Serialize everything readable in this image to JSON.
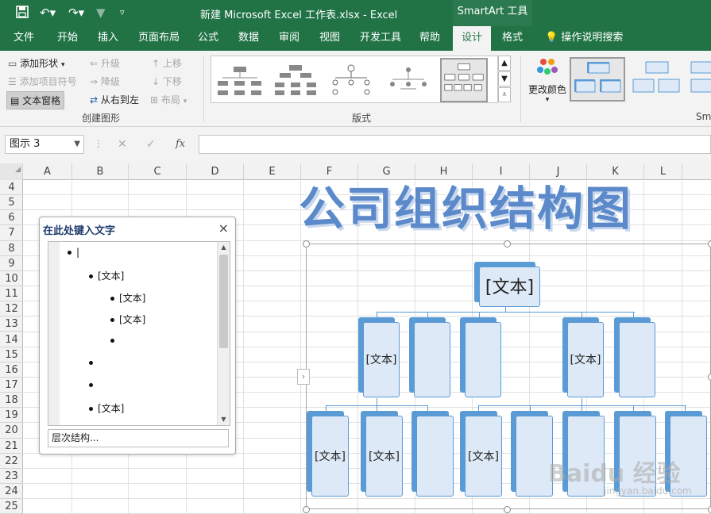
{
  "title_bar": {
    "doc_title": "新建 Microsoft Excel 工作表.xlsx  -  Excel",
    "context_label": "SmartArt 工具"
  },
  "tabs": [
    "文件",
    "开始",
    "插入",
    "页面布局",
    "公式",
    "数据",
    "审阅",
    "视图",
    "开发工具",
    "帮助",
    "设计",
    "格式"
  ],
  "active_tab": "设计",
  "tell_me": "操作说明搜索",
  "ribbon": {
    "create_graphic": {
      "add_shape": "添加形状",
      "add_bullet": "添加项目符号",
      "text_pane": "文本窗格",
      "promote": "升级",
      "demote": "降级",
      "right_to_left": "从右到左",
      "move_up": "上移",
      "move_down": "下移",
      "layout": "布局",
      "group_label": "创建图形"
    },
    "layouts": {
      "group_label": "版式"
    },
    "change_colors": "更改颜色",
    "styles_label_partial": "Sm"
  },
  "formula_bar": {
    "name_box": "图示 3",
    "cancel": "✕",
    "enter": "✓",
    "fx": "fx",
    "value": ""
  },
  "columns": [
    "A",
    "B",
    "C",
    "D",
    "E",
    "F",
    "G",
    "H",
    "I",
    "J",
    "K",
    "L"
  ],
  "rows": [
    "4",
    "5",
    "6",
    "7",
    "8",
    "9",
    "10",
    "11",
    "12",
    "13",
    "14",
    "15",
    "16",
    "17",
    "18",
    "19",
    "20",
    "21",
    "22",
    "23",
    "24",
    "25"
  ],
  "text_pane": {
    "title": "在此处键入文字",
    "close": "×",
    "bullets": [
      "",
      "[文本]",
      "[文本]",
      "[文本]",
      "",
      "",
      "",
      "[文本]"
    ],
    "footer": "层次结构..."
  },
  "wordart_title": "公司组织结构图",
  "smartart": {
    "top": "[文本]",
    "level2": [
      "[文本]",
      "",
      "",
      "[文本]",
      ""
    ],
    "level3": [
      "[文本]",
      "[文本]",
      "",
      "[文本]",
      "",
      "",
      "",
      ""
    ]
  },
  "watermark": {
    "main": "Baidu 经验",
    "sub": "jingyan.baidu.com"
  },
  "colors": {
    "excel_green": "#217346",
    "smartart_blue": "#5b9bd5",
    "box_fill": "#dde9f7"
  }
}
